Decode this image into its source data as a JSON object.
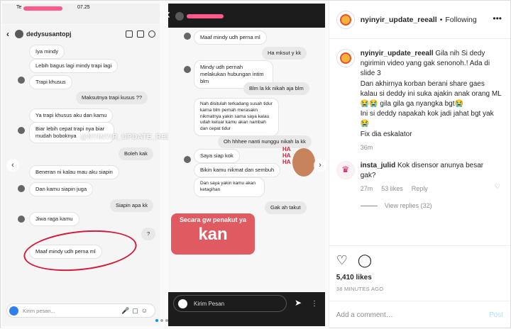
{
  "left_chat": {
    "status_time": "07.25",
    "status_label": "Te",
    "header_name": "dedysusantopj",
    "messages": [
      {
        "side": "in",
        "text": "Iya mindy"
      },
      {
        "side": "in",
        "text": "Lebih bagus lagi mindy trapi lagi"
      },
      {
        "side": "in",
        "text": "Trapi khusus"
      },
      {
        "side": "out",
        "text": "Maksutnya trapi kusus ??"
      },
      {
        "side": "in",
        "text": "Ya trapi khusus aku dan kamu"
      },
      {
        "side": "in",
        "text": "Biar lebih cepat trapi nya biar mudah boboknya"
      },
      {
        "side": "out",
        "text": "Boleh kak"
      },
      {
        "side": "in",
        "text": "Beneran ni kalau mau aku siapin"
      },
      {
        "side": "in",
        "text": "Dan kamu siapin juga"
      },
      {
        "side": "out",
        "text": "Siapin apa kk"
      },
      {
        "side": "in",
        "text": "Jiwa raga kamu"
      },
      {
        "side": "out",
        "text": "?"
      },
      {
        "side": "in",
        "text": "Maaf mindy udh perna ml"
      }
    ],
    "composer_placeholder": "Kirim pesan...",
    "watermark": "@NYINYIR_UPDATE_REEALL"
  },
  "right_chat": {
    "messages": [
      {
        "side": "in",
        "text": "Maaf mindy udh perna ml"
      },
      {
        "side": "out",
        "text": "Ha mksut y kk"
      },
      {
        "side": "in",
        "text": "Mindy udh pernah melakukan hubungan intim blm"
      },
      {
        "side": "out",
        "text": "Blm la kk nikah aja blm"
      },
      {
        "side": "in",
        "text": "Nah disitulah terkadang susah tidur karna blm pernah merasakn nikmatnya yakin sama saya kalau udah keluar kamu akan nambah dan cepat tidur"
      },
      {
        "side": "out",
        "text": "Oh hhhee nanti nunggu nikah la kk"
      },
      {
        "side": "in",
        "text": "Saya siap kok"
      },
      {
        "side": "in",
        "text": "Bikin kamu nikmat dan sembuh"
      },
      {
        "side": "in",
        "text": "Dan saya yakin kamu akan ketagihan"
      },
      {
        "side": "out",
        "text": "Gak ah takut"
      }
    ],
    "sticker_line1": "Secara gw penakut ya",
    "sticker_line2": "kan",
    "haha_text": "HA HA HA",
    "composer_placeholder": "Kirim Pesan"
  },
  "post": {
    "username": "nyinyir_update_reeall",
    "follow_label": "Following",
    "caption_user": "nyinyir_update_reeall",
    "caption_text": "Gila nih Si dedy ngirimin video yang gak senonoh.! Ada di slide 3\nDan akhirnya korban berani share gaes kalau si deddy ini suka ajakin anak orang ML😭😭 gila gila ga nyangka bgt😭\nIni si deddy napakah kok jadi jahat bgt yak😭\nFix dia eskalator",
    "caption_time": "36m",
    "comment_user": "insta_julid",
    "comment_text": "Kok disensor anunya besar gak?",
    "comment_time": "27m",
    "comment_likes": "53 likes",
    "reply_label": "Reply",
    "view_replies": "View replies (32)",
    "likes": "5,410 likes",
    "posted": "38 MINUTES AGO",
    "add_comment_placeholder": "Add a comment…",
    "post_button": "Post"
  },
  "colors": {
    "accent": "#0095f6",
    "circle": "#d21e3c",
    "sticker": "#e05a62"
  },
  "carousel": {
    "current_slide": 1,
    "total_slides": 3
  }
}
